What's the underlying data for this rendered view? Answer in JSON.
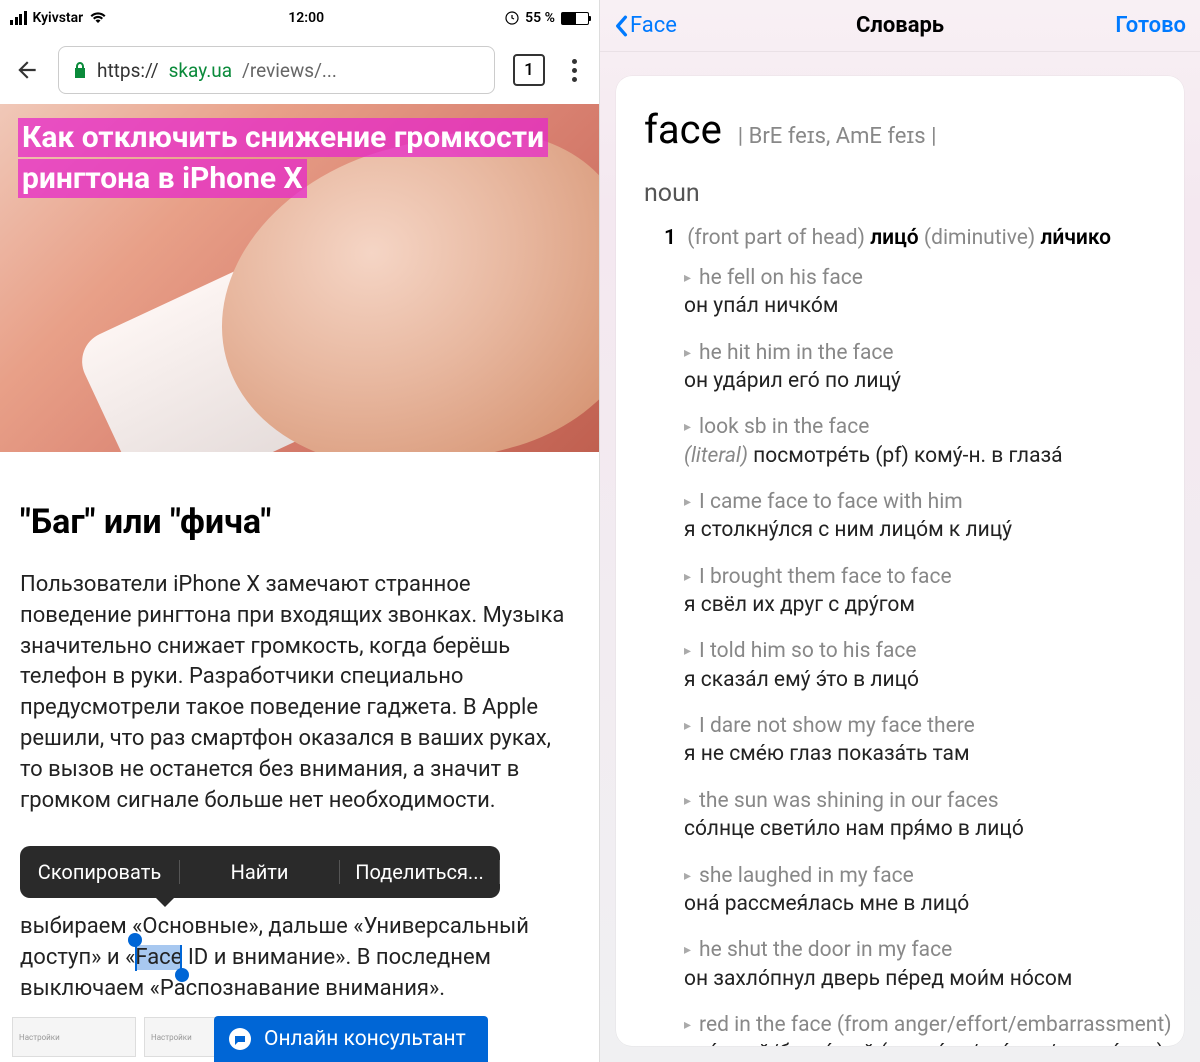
{
  "left": {
    "status": {
      "carrier": "Kyivstar",
      "time": "12:00",
      "battery_pct": "55 %"
    },
    "chrome": {
      "url_prefix": "https://",
      "url_domain": "skay.ua",
      "url_rest": "/reviews/...",
      "tab_count": "1"
    },
    "hero": {
      "title": "Как отключить снижение громкости рингтона в iPhone X"
    },
    "article": {
      "subheading": "\"Баг\" или \"фича\"",
      "body1": "Пользователи iPhone X замечают странное поведение рингтона при входящих звонках. Музыка значительно снижает громкость, когда берёшь телефон в руки. Разработчики специально предусмотрели такое поведение гаджета. В Apple решили, что раз смартфон оказался в ваших руках, то вызов не останется без внимания, а значит в громком сигнале больше нет необходимости.",
      "body2_pre": "выбираем «Основные», дальше «Универсальный доступ» и «",
      "body2_sel": "Face",
      "body2_post": " ID и внимание». В последнем выключаем «Распознавание внимания»."
    },
    "popup": {
      "copy": "Скопировать",
      "find": "Найти",
      "share": "Поделиться..."
    },
    "chat_label": "Онлайн консультант",
    "thumb_label": "Настройки"
  },
  "right": {
    "nav": {
      "back": "Face",
      "title": "Словарь",
      "done": "Готово"
    },
    "entry": {
      "headword": "face",
      "phonetic": "| BrE feɪs, AmE feɪs |",
      "pos": "noun",
      "sense_num": "1",
      "sense_gloss": "(front part of head)",
      "sense_trans1": "лицо́",
      "sense_dim": "(diminutive)",
      "sense_trans2": "ли́чико",
      "examples": [
        {
          "en": "he fell on his face",
          "ru": "он упа́л ничко́м"
        },
        {
          "en": "he hit him in the face",
          "ru": "он уда́рил его́ по лицу́"
        },
        {
          "en": "look sb in the face",
          "note": "(literal)",
          "ru": "посмотре́ть (pf) кому́-н. в глаза́"
        },
        {
          "en": "I came face to face with him",
          "ru": "я столкну́лся с ним лицо́м к лицу́"
        },
        {
          "en": "I brought them face to face",
          "ru": "я свёл их друг с дру́гом"
        },
        {
          "en": "I told him so to his face",
          "ru": "я сказа́л ему́ э́то в лицо́"
        },
        {
          "en": "I dare not show my face there",
          "ru": "я не сме́ю глаз показа́ть там"
        },
        {
          "en": "the sun was shining in our faces",
          "ru": "со́лнце свети́ло нам пря́мо в лицо́"
        },
        {
          "en": "she laughed in my face",
          "ru": "она́ рассмея́лась мне в лицо́"
        },
        {
          "en": "he shut the door in my face",
          "ru": "он захло́пнул дверь пе́ред мои́м но́сом"
        },
        {
          "en": "red in the face (from anger/effort/embarrassment)",
          "ru": "кра́сный/багро́вый (от гне́ва/уси́лия/смуще́ния)"
        }
      ]
    }
  }
}
